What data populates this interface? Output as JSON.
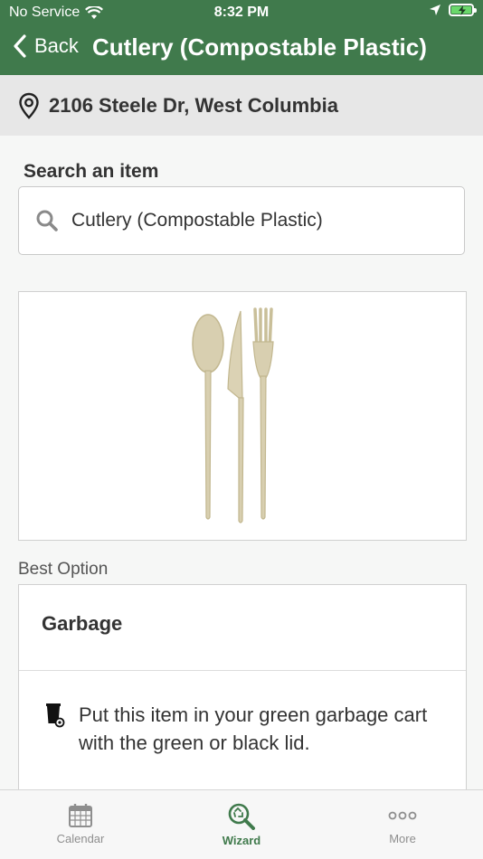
{
  "status_bar": {
    "carrier": "No Service",
    "time": "8:32 PM"
  },
  "nav": {
    "back_label": "Back",
    "title": "Cutlery (Compostable Plastic)"
  },
  "address": {
    "text": "2106 Steele Dr, West Columbia"
  },
  "search": {
    "label": "Search an item",
    "value": "Cutlery (Compostable Plastic)"
  },
  "item_image": {
    "icon": "compostable-cutlery-image"
  },
  "best_option": {
    "section_label": "Best Option",
    "title": "Garbage",
    "instruction": "Put this item in your green garbage cart with the green or black lid."
  },
  "tabs": [
    {
      "label": "Calendar",
      "icon": "calendar-icon",
      "active": false
    },
    {
      "label": "Wizard",
      "icon": "wizard-search-icon",
      "active": true
    },
    {
      "label": "More",
      "icon": "more-dots-icon",
      "active": false
    }
  ],
  "colors": {
    "brand_green": "#407a4c",
    "tab_inactive": "#8e8e8e"
  }
}
